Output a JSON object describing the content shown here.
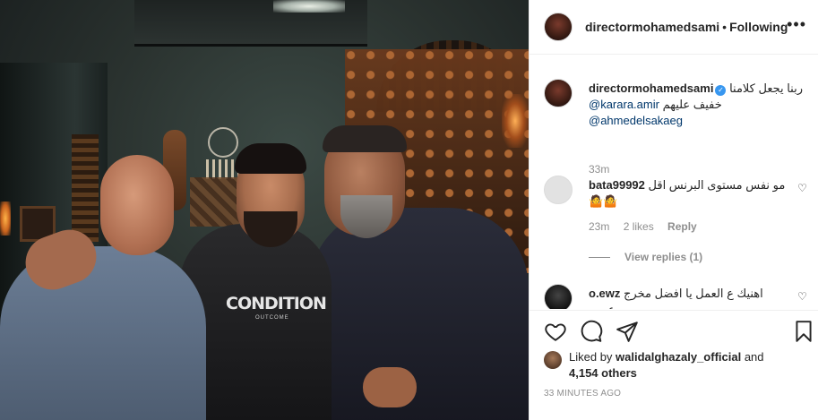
{
  "header": {
    "username": "directormohamedsami",
    "separator": "•",
    "follow_label": "Following",
    "more_icon": "more-horizontal-icon"
  },
  "caption": {
    "username": "directormohamedsami",
    "text_arabic_1": "ربنا يجعل كلامنا",
    "mention_1": "@karara.amir",
    "text_arabic_2": "خفيف عليهم",
    "mention_2": "@ahmedelsakaeg",
    "time": "33m"
  },
  "comments": [
    {
      "username": "bata99992",
      "text": "مو نفس مستوى البرنس اقل",
      "emoji": "🤷🤷",
      "time": "23m",
      "likes": "2 likes",
      "reply": "Reply",
      "view_replies": "View replies (1)"
    },
    {
      "username": "o.ewz",
      "text": "اهنيك ع العمل يا افضل مخرج عربي",
      "emoji": "👏👏"
    }
  ],
  "photo": {
    "shirt_text": "CONDITION",
    "shirt_subtext": "OUTCOME"
  },
  "likes": {
    "prefix": "Liked by",
    "user": "walidalghazaly_official",
    "conj": "and",
    "others": "4,154 others"
  },
  "timestamp": "33 MINUTES AGO",
  "colors": {
    "text": "#262626",
    "muted": "#8e8e8e",
    "link": "#00376b",
    "verified": "#3897f0",
    "border": "#efefef"
  }
}
